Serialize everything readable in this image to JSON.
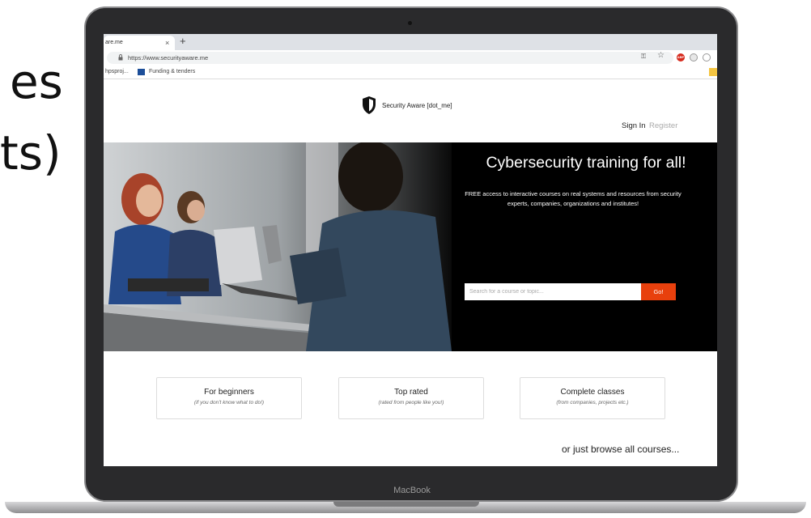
{
  "slide": {
    "line1": "es",
    "line2": "ts)"
  },
  "laptop": {
    "label": "MacBook"
  },
  "browser": {
    "tab_title": "are.me",
    "tab_close": "×",
    "new_tab": "+",
    "url": "https://www.securityaware.me",
    "ext_badge": "ABP",
    "bookmarks": [
      {
        "label": "hpsproj..."
      },
      {
        "label": "Funding & tenders"
      }
    ]
  },
  "page": {
    "brand": "Security Aware [dot_me]",
    "signin": "Sign In",
    "register": "Register",
    "hero": {
      "title": "Cybersecurity training for all!",
      "subtitle": "FREE access to interactive courses on real systems and resources from security experts, companies, organizations and institutes!",
      "search_placeholder": "Search for a course or topic...",
      "search_button": "Go!"
    },
    "cards": [
      {
        "title": "For beginners",
        "subtitle": "(if you don't know what to do!)"
      },
      {
        "title": "Top rated",
        "subtitle": "(rated from people like you!)"
      },
      {
        "title": "Complete classes",
        "subtitle": "(from companies, projects etc.)"
      }
    ],
    "browse": "or just browse all courses..."
  },
  "colors": {
    "accent": "#e8400d",
    "hero_bg": "#000000",
    "bookmark_icon": "#1c4e99"
  },
  "icons": [
    "shield-icon",
    "lock-icon",
    "key-icon",
    "star-icon",
    "close-icon",
    "plus-icon"
  ]
}
